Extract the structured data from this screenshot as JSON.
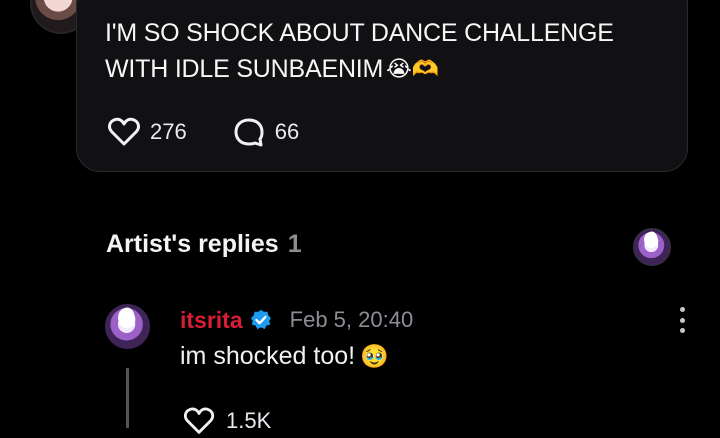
{
  "post": {
    "text": "I'M SO SHOCK ABOUT DANCE CHALLENGE WITH IDLE SUNBAENIM",
    "emojis": "😭🫶",
    "likes": "276",
    "comments": "66",
    "icons": [
      "heart-icon",
      "comment-bubble-icon"
    ]
  },
  "section": {
    "title": "Artist's replies",
    "count": "1"
  },
  "reply": {
    "username": "itsrita",
    "timestamp": "Feb 5, 20:40",
    "text": "im shocked too!",
    "emoji": "🥹",
    "likes": "1.5K",
    "icons": [
      "verified-badge-icon",
      "more-vertical-icon",
      "heart-icon"
    ]
  },
  "colors": {
    "background": "#000000",
    "card": "#111114",
    "username_red": "#d81d35",
    "verified_blue": "#1d9bf0",
    "muted_text": "#8d8d95"
  }
}
